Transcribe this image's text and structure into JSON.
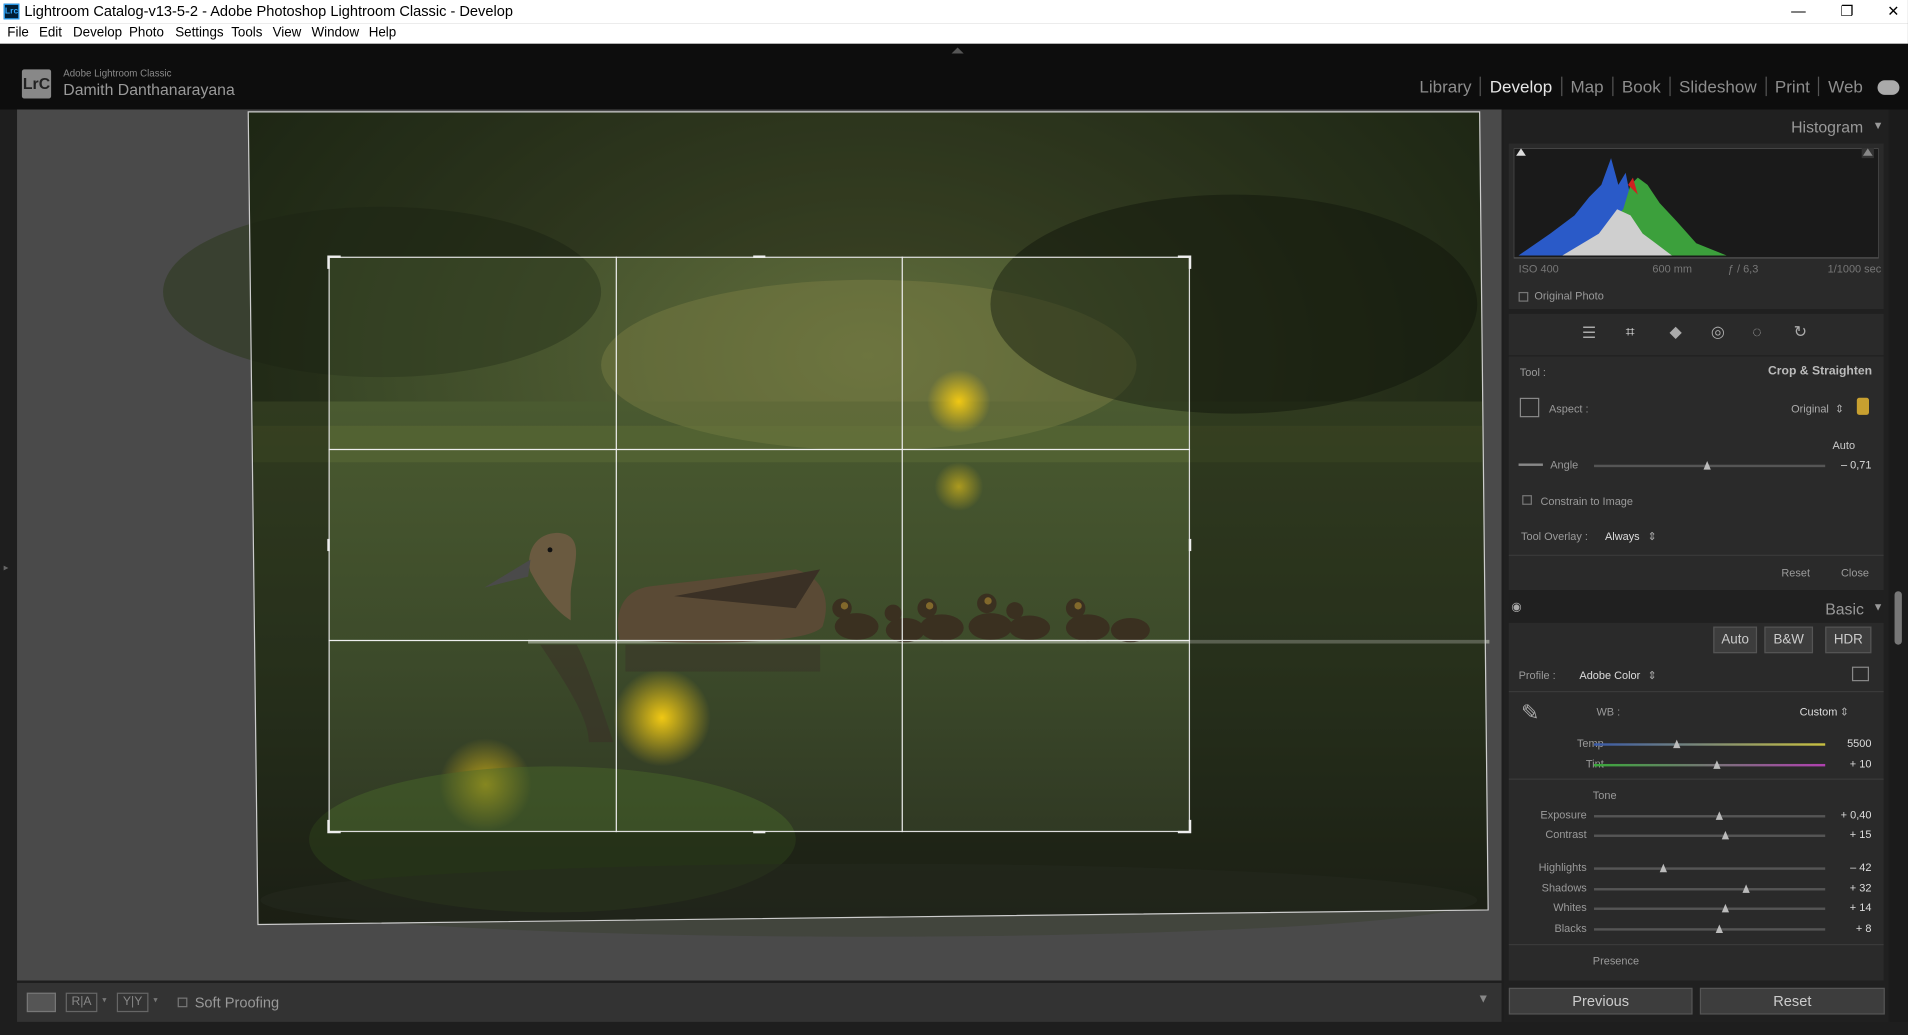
{
  "window": {
    "title": "Lightroom Catalog-v13-5-2 - Adobe Photoshop Lightroom Classic - Develop",
    "app_icon": "Lrc",
    "controls": {
      "min": "—",
      "max": "❐",
      "close": "✕"
    }
  },
  "menu": [
    "File",
    "Edit",
    "Develop",
    "Photo",
    "Settings",
    "Tools",
    "View",
    "Window",
    "Help"
  ],
  "identity": {
    "logo": "LrC",
    "product": "Adobe Lightroom Classic",
    "user": "Damith Danthanarayana"
  },
  "modules": [
    "Library",
    "Develop",
    "Map",
    "Book",
    "Slideshow",
    "Print",
    "Web"
  ],
  "active_module": "Develop",
  "histogram": {
    "title": "Histogram",
    "iso": "ISO 400",
    "focal": "600 mm",
    "aperture": "ƒ / 6,3",
    "shutter": "1/1000 sec",
    "original_photo": "Original Photo"
  },
  "crop": {
    "tool_label": "Tool :",
    "tool_name": "Crop & Straighten",
    "aspect_label": "Aspect :",
    "aspect_value": "Original",
    "auto": "Auto",
    "angle_label": "Angle",
    "angle_value": "– 0,71",
    "angle_pos": 0.49,
    "constrain": "Constrain to Image",
    "overlay_label": "Tool Overlay :",
    "overlay_value": "Always",
    "reset": "Reset",
    "close": "Close"
  },
  "basic": {
    "title": "Basic",
    "buttons": [
      "Auto",
      "B&W",
      "HDR"
    ],
    "profile_label": "Profile :",
    "profile_value": "Adobe Color",
    "wb_label": "WB :",
    "wb_value": "Custom",
    "temp": {
      "label": "Temp",
      "value": "5500",
      "pos": 0.36
    },
    "tint": {
      "label": "Tint",
      "value": "+ 10",
      "pos": 0.53
    },
    "tone_label": "Tone",
    "exposure": {
      "label": "Exposure",
      "value": "+ 0,40",
      "pos": 0.54
    },
    "contrast": {
      "label": "Contrast",
      "value": "+ 15",
      "pos": 0.57
    },
    "highlights": {
      "label": "Highlights",
      "value": "– 42",
      "pos": 0.3
    },
    "shadows": {
      "label": "Shadows",
      "value": "+ 32",
      "pos": 0.66
    },
    "whites": {
      "label": "Whites",
      "value": "+ 14",
      "pos": 0.57
    },
    "blacks": {
      "label": "Blacks",
      "value": "+ 8",
      "pos": 0.54
    },
    "presence_label": "Presence"
  },
  "toolbar": {
    "soft_proofing": "Soft Proofing"
  },
  "footer": {
    "previous": "Previous",
    "reset": "Reset"
  },
  "colors": {
    "accent": "#e6e6e6",
    "panel": "#2a2a2a",
    "background": "#4a4a4a"
  }
}
